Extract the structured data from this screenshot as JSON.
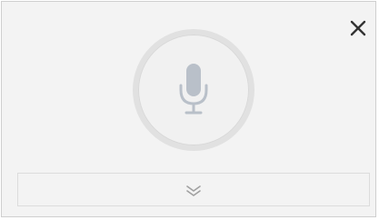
{
  "dialog": {
    "close_icon": "close-icon",
    "mic_icon": "microphone-icon",
    "expand_icon": "double-chevron-down-icon"
  },
  "colors": {
    "panel_background": "#f3f3f3",
    "mic_ring": "#e1e1e1",
    "mic_icon": "#b9c0c9",
    "close_icon": "#333333",
    "chevron": "#a0a0a0"
  }
}
